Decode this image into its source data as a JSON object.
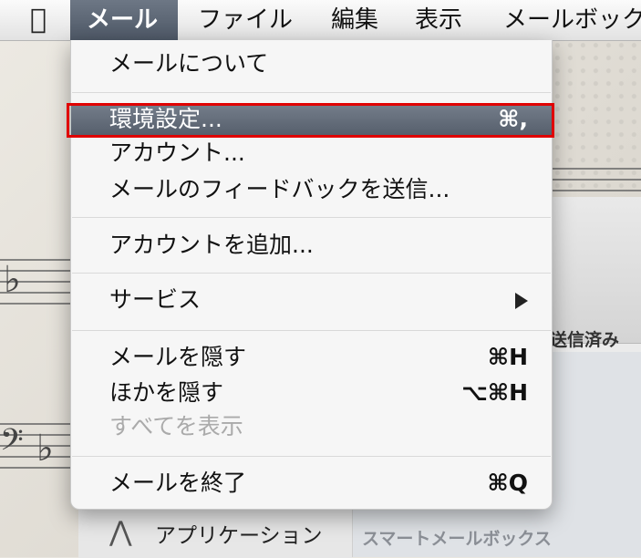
{
  "menubar": {
    "apple_icon": "apple-logo-icon",
    "menus": [
      "メール",
      "ファイル",
      "編集",
      "表示",
      "メールボック"
    ]
  },
  "menu": {
    "items": [
      {
        "label": "メールについて",
        "shortcut": ""
      },
      {
        "label": "環境設定...",
        "shortcut": "⌘,"
      },
      {
        "label": "アカウント...",
        "shortcut": ""
      },
      {
        "label": "メールのフィードバックを送信...",
        "shortcut": ""
      },
      {
        "label": "アカウントを追加...",
        "shortcut": ""
      },
      {
        "label": "サービス",
        "shortcut": ""
      },
      {
        "label": "メールを隠す",
        "shortcut": "⌘H"
      },
      {
        "label": "ほかを隠す",
        "shortcut": "⌥⌘H"
      },
      {
        "label": "すべてを表示",
        "shortcut": ""
      },
      {
        "label": "メールを終了",
        "shortcut": "⌘Q"
      }
    ],
    "highlight_color": "#e00000"
  },
  "background": {
    "sent_label": "送信済み",
    "smart_mailbox_label": "スマートメールボックス",
    "app_label": "アプリケーション"
  }
}
